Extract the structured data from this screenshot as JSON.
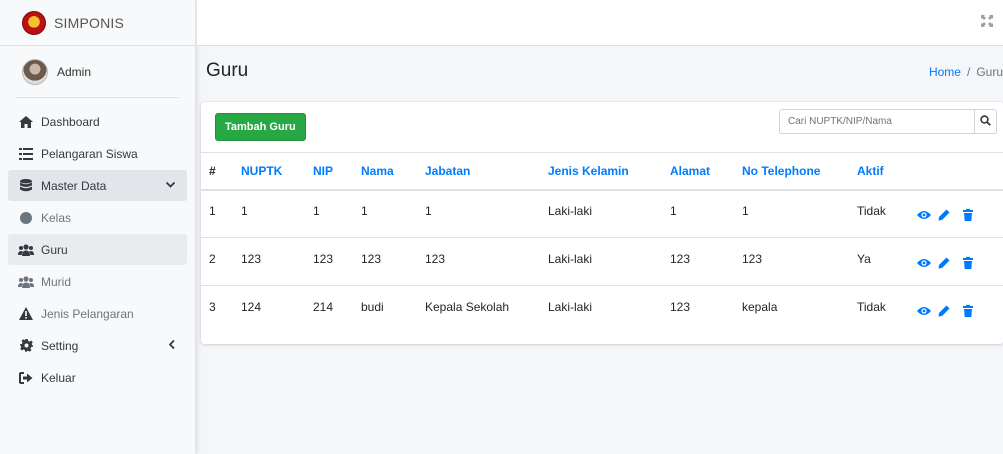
{
  "brand": {
    "name": "SIMPONIS"
  },
  "user": {
    "name": "Admin"
  },
  "sidebar": {
    "items": [
      {
        "label": "Dashboard",
        "icon": "home-icon"
      },
      {
        "label": "Pelangaran Siswa",
        "icon": "list-icon"
      },
      {
        "label": "Master Data",
        "icon": "database-icon"
      },
      {
        "label": "Kelas",
        "icon": "circle-icon"
      },
      {
        "label": "Guru",
        "icon": "users-icon"
      },
      {
        "label": "Murid",
        "icon": "users-icon"
      },
      {
        "label": "Jenis Pelangaran",
        "icon": "warning-icon"
      },
      {
        "label": "Setting",
        "icon": "cog-icon"
      },
      {
        "label": "Keluar",
        "icon": "sign-out-icon"
      }
    ]
  },
  "header": {
    "title": "Guru",
    "breadcrumb": {
      "home": "Home",
      "separator": "/",
      "current": "Guru"
    }
  },
  "toolbar": {
    "add_label": "Tambah Guru",
    "search_placeholder": "Cari NUPTK/NIP/Nama"
  },
  "table": {
    "columns": [
      "#",
      "NUPTK",
      "NIP",
      "Nama",
      "Jabatan",
      "Jenis Kelamin",
      "Alamat",
      "No Telephone",
      "Aktif"
    ],
    "rows": [
      [
        "1",
        "1",
        "1",
        "1",
        "1",
        "Laki-laki",
        "1",
        "1",
        "Tidak"
      ],
      [
        "2",
        "123",
        "123",
        "123",
        "123",
        "Laki-laki",
        "123",
        "123",
        "Ya"
      ],
      [
        "3",
        "124",
        "214",
        "budi",
        "Kepala Sekolah",
        "Laki-laki",
        "123",
        "kepala",
        "Tidak"
      ]
    ]
  },
  "colors": {
    "accent": "#007bff",
    "success": "#28a745",
    "sidebar_bg": "#f8f9fa",
    "content_bg": "#f4f6f9"
  }
}
